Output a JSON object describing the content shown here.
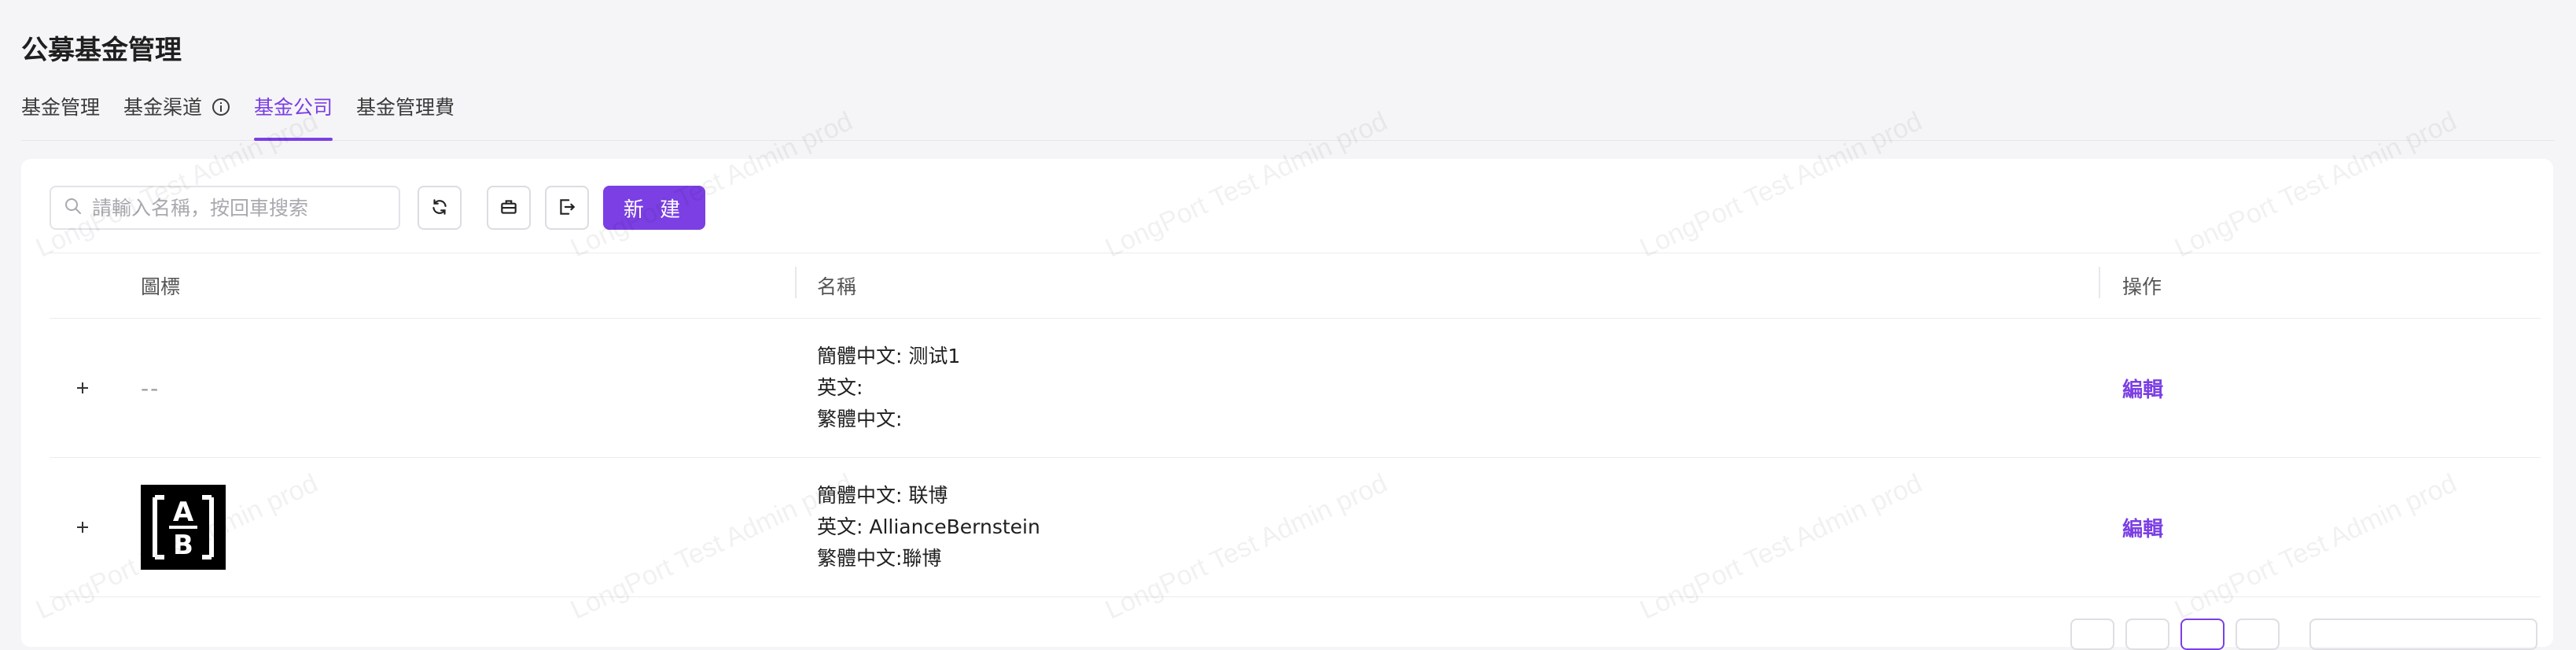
{
  "page": {
    "title": "公募基金管理"
  },
  "tabs": [
    {
      "label": "基金管理",
      "active": false
    },
    {
      "label": "基金渠道",
      "active": false,
      "has_info_icon": true
    },
    {
      "label": "基金公司",
      "active": true
    },
    {
      "label": "基金管理費",
      "active": false
    }
  ],
  "toolbar": {
    "search_placeholder": "請輸入名稱，按回車搜索",
    "new_label": "新 建",
    "icons": [
      "refresh-icon",
      "briefcase-icon",
      "export-icon"
    ]
  },
  "table": {
    "columns": {
      "logo": "圖標",
      "name": "名稱",
      "ops": "操作"
    },
    "rows": [
      {
        "logo": "--",
        "simplified": "簡體中文: 测试1",
        "english": "英文:",
        "traditional": "繁體中文:",
        "action": "編輯"
      },
      {
        "logo_text_top": "A",
        "logo_text_bottom": "B",
        "simplified": "簡體中文: 联博",
        "english": "英文: AllianceBernstein",
        "traditional": "繁體中文:聯博",
        "action": "編輯"
      }
    ]
  },
  "watermark": "LongPort Test Admin prod",
  "colors": {
    "accent": "#7b3fe4",
    "background": "#f5f5f7",
    "card": "#ffffff"
  }
}
